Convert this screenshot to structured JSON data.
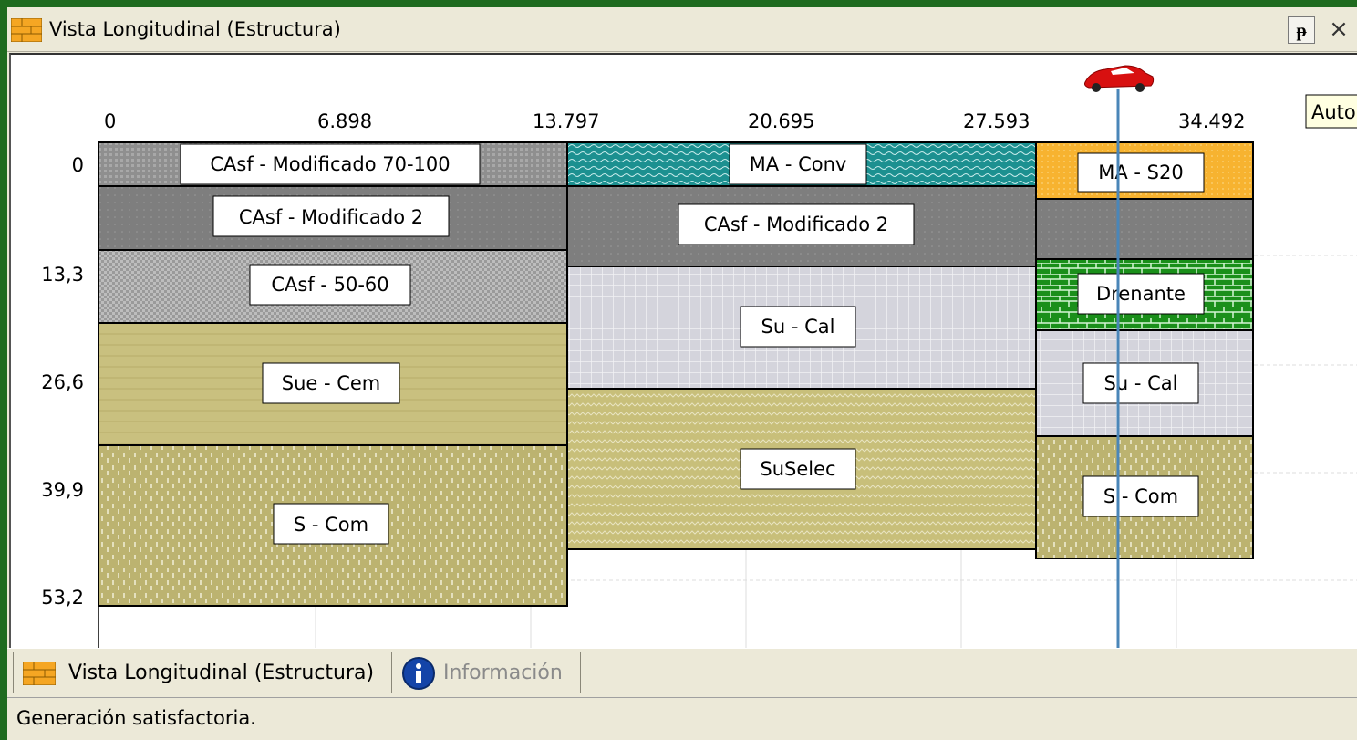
{
  "window": {
    "title": "Vista Longitudinal (Estructura)",
    "pin_icon": "pin-icon",
    "close_glyph": "×"
  },
  "x_ticks": [
    "0",
    "6.898",
    "13.797",
    "20.695",
    "27.593",
    "34.492"
  ],
  "y_ticks": [
    "0",
    "13,3",
    "26,6",
    "39,9",
    "53,2"
  ],
  "auto_label": "Auto",
  "layers": [
    {
      "label": "CAsf - Modificado 70-100"
    },
    {
      "label": "CAsf - Modificado 2"
    },
    {
      "label": "CAsf - 50-60"
    },
    {
      "label": "Sue - Cem"
    },
    {
      "label": "S - Com"
    },
    {
      "label": "MA - Conv"
    },
    {
      "label": "CAsf - Modificado 2"
    },
    {
      "label": "Su - Cal"
    },
    {
      "label": "SuSelec"
    },
    {
      "label": "MA - S20"
    },
    {
      "label": "Drenante"
    },
    {
      "label": "Su - Cal"
    },
    {
      "label": "S - Com"
    }
  ],
  "tabs": {
    "structure": "Vista Longitudinal (Estructura)",
    "info": "Información"
  },
  "status": "Generación satisfactoria."
}
